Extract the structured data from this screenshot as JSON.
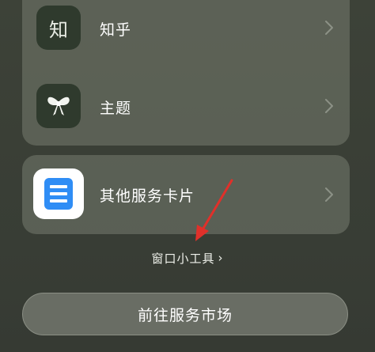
{
  "list": {
    "items": [
      {
        "id": "zhihu",
        "label": "知乎",
        "icon_text": "知",
        "icon": "zhihu-logo-icon"
      },
      {
        "id": "theme",
        "label": "主题",
        "icon": "bow-icon"
      }
    ]
  },
  "service_card": {
    "label": "其他服务卡片",
    "icon": "service-card-icon"
  },
  "widget_link": {
    "label": "窗口小工具",
    "arrow": "›"
  },
  "market_button": {
    "label": "前往服务市场"
  },
  "colors": {
    "annotation_arrow": "#e0302a",
    "service_icon_blue": "#2f8df5"
  }
}
